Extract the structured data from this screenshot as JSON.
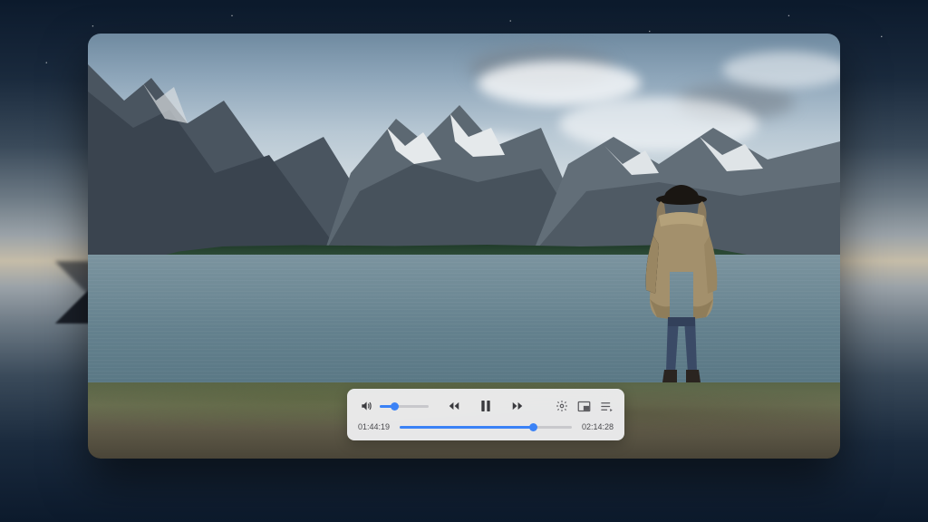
{
  "player": {
    "volume_percent": 30,
    "elapsed": "01:44:19",
    "total": "02:14:28",
    "progress_percent": 77.6,
    "state": "playing",
    "icons": {
      "volume": "volume-icon",
      "rewind": "rewind-icon",
      "pause": "pause-icon",
      "forward": "forward-icon",
      "settings": "gear-icon",
      "pip": "pip-icon",
      "playlist": "playlist-icon"
    },
    "colors": {
      "accent": "#3b82f6",
      "track": "#c8c8cc",
      "panel": "rgba(240,240,242,.94)"
    }
  }
}
